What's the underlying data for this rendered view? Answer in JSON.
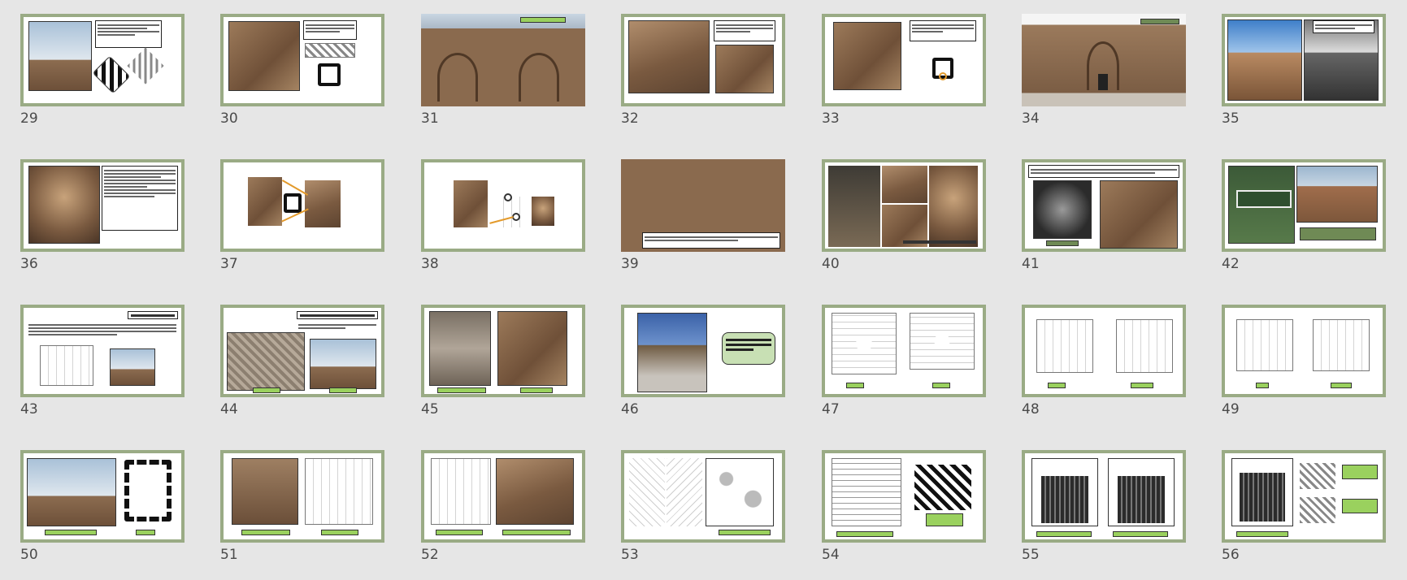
{
  "app": {
    "view": "Slide Sorter"
  },
  "colors": {
    "frame": "#9aab85",
    "label_green": "#9ad15e",
    "background": "#e6e6e6"
  },
  "slides": [
    {
      "number": "29"
    },
    {
      "number": "30"
    },
    {
      "number": "31"
    },
    {
      "number": "32"
    },
    {
      "number": "33"
    },
    {
      "number": "34"
    },
    {
      "number": "35"
    },
    {
      "number": "36"
    },
    {
      "number": "37"
    },
    {
      "number": "38"
    },
    {
      "number": "39"
    },
    {
      "number": "40"
    },
    {
      "number": "41"
    },
    {
      "number": "42"
    },
    {
      "number": "43"
    },
    {
      "number": "44"
    },
    {
      "number": "45"
    },
    {
      "number": "46"
    },
    {
      "number": "47"
    },
    {
      "number": "48"
    },
    {
      "number": "49"
    },
    {
      "number": "50"
    },
    {
      "number": "51"
    },
    {
      "number": "52"
    },
    {
      "number": "53"
    },
    {
      "number": "54"
    },
    {
      "number": "55"
    },
    {
      "number": "56"
    }
  ],
  "slide_text": {
    "s31_label": "آجر کاریهای گنبد علویان",
    "s34_label": "نمای ورودی گنبد علویان",
    "s41_label": "سرداب گنبد علویان",
    "s42_label_1": "پروژه برداشت گنبد علویان به عنوان یکی از",
    "s42_label_2": "مجموعه های گردشگری همدان",
    "s42_sign": "Alavian Tomb",
    "s43_title": "شکل اصلی مقبره پیش از بنا",
    "s44_title": "مصالح اصلی مورد استفاده در گنبد علویان",
    "s46_text": "در ادامه تصاویری از نقشه ها، دیوارها و سقف گنبد علویان ارائه می گردد :"
  }
}
